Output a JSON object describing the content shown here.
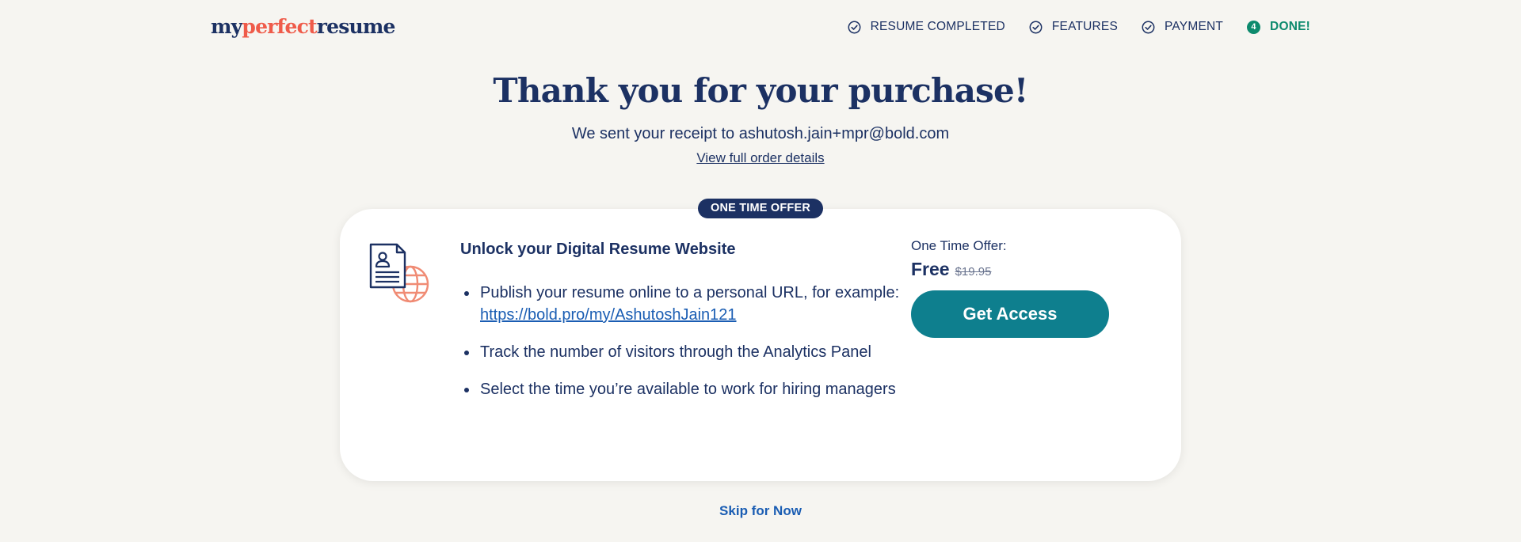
{
  "logo": {
    "part1": "my",
    "part2": "perfect",
    "part3": "resume"
  },
  "steps": [
    {
      "label": "RESUME COMPLETED",
      "state": "complete"
    },
    {
      "label": "FEATURES",
      "state": "complete"
    },
    {
      "label": "PAYMENT",
      "state": "complete"
    },
    {
      "label": "DONE!",
      "state": "current",
      "number": "4"
    }
  ],
  "main": {
    "headline": "Thank you for your purchase!",
    "receipt_text": "We sent your receipt to ashutosh.jain+mpr@bold.com",
    "order_link": "View full order details"
  },
  "offer": {
    "badge": "ONE TIME OFFER",
    "title": "Unlock your Digital Resume Website",
    "features": [
      {
        "text": "Publish your resume online to a personal URL, for example:",
        "url": "https://bold.pro/my/AshutoshJain121"
      },
      {
        "text": "Track the number of visitors through the Analytics Panel"
      },
      {
        "text": "Select the time you’re available to work for hiring managers"
      }
    ],
    "offer_label": "One Time Offer:",
    "price": "Free",
    "old_price": "$19.95",
    "cta": "Get Access",
    "icon": "resume-web-icon"
  },
  "skip_label": "Skip for Now",
  "colors": {
    "navy": "#1c3163",
    "coral": "#ef5b4a",
    "teal_button": "#0e7f8e",
    "done_green": "#0d8a6d",
    "link_blue": "#1a5db3",
    "background": "#f6f5f1"
  }
}
